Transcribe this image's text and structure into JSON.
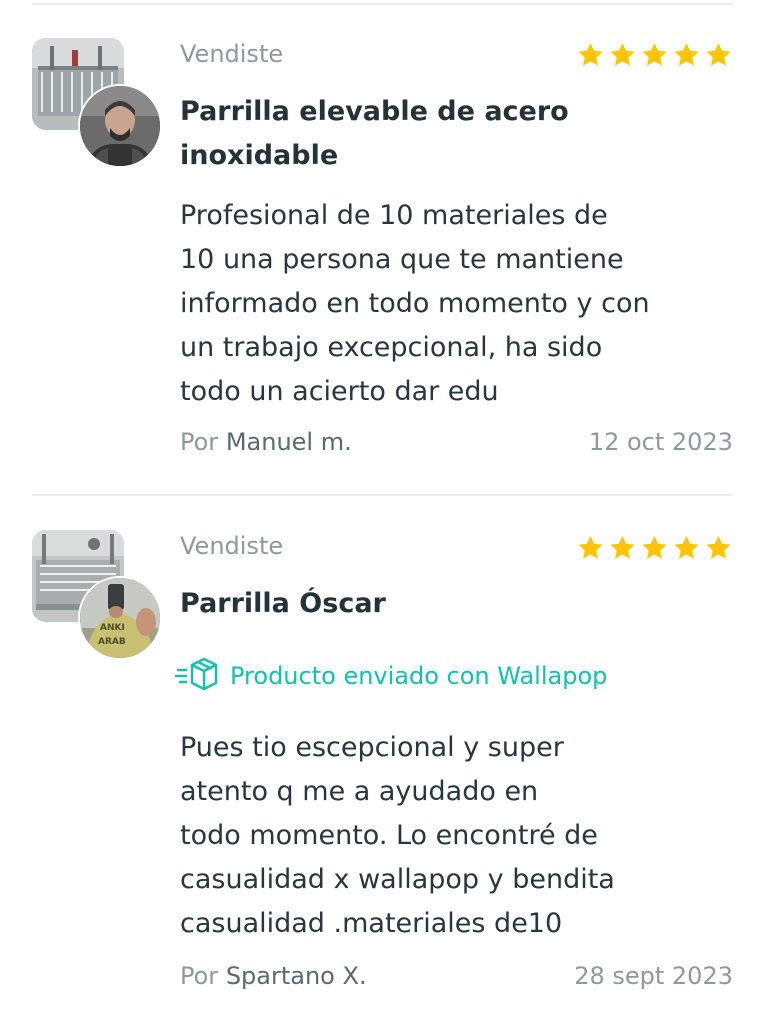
{
  "colors": {
    "star": "#fdc500",
    "accent": "#13c1ac",
    "text": "#29363d",
    "muted": "#90989f"
  },
  "reviews": [
    {
      "type_label": "Vendiste",
      "rating": 5,
      "title": "Parrilla elevable de acero inoxidable",
      "body": "Profesional de 10 materiales de\n10 una persona que te mantiene\ninformado en todo momento y con\nun trabajo excepcional, ha sido\ntodo un acierto dar edu",
      "by_prefix": "Por",
      "author": "Manuel m.",
      "date": "12 oct 2023"
    },
    {
      "type_label": "Vendiste",
      "rating": 5,
      "title": "Parrilla Óscar",
      "shipping_label": "Producto enviado con Wallapop",
      "body": "Pues tio escepcional y super\natento q me a ayudado en\ntodo momento. Lo encontré de\ncasualidad x wallapop y  bendita\ncasualidad .materiales de10",
      "by_prefix": "Por",
      "author": "Spartano X.",
      "date": "28 sept 2023"
    }
  ]
}
